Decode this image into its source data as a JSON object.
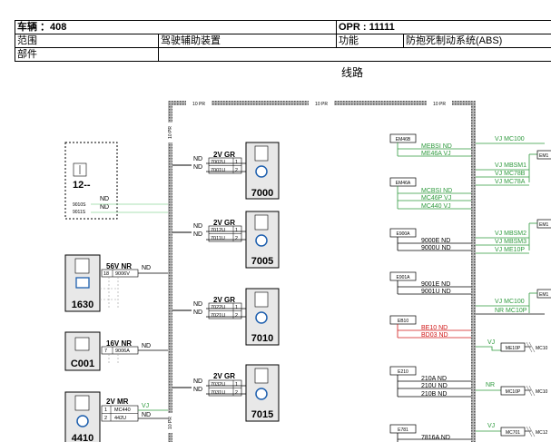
{
  "header": {
    "vehicle": "车辆 ：408",
    "opr": "OPR : 11111",
    "scope_label": "范围",
    "scope_value": "驾驶辅助装置",
    "function_label": "功能",
    "function_value": "防抱死制动系统(ABS)",
    "parts_label": "部件",
    "parts_value": ""
  },
  "diagram_title": "线路",
  "frame": {
    "top_labels": [
      "10 PR",
      "10 PR",
      "10 PR"
    ],
    "side_label": "10 PR"
  },
  "sensors": [
    {
      "id": "7000",
      "wire": "2V GR",
      "ends": [
        "ND",
        "ND"
      ],
      "pins": [
        [
          "7002U",
          "1"
        ],
        [
          "7001U",
          "2"
        ]
      ]
    },
    {
      "id": "7005",
      "wire": "2V GR",
      "ends": [
        "ND",
        "ND"
      ],
      "pins": [
        [
          "7012U",
          "1"
        ],
        [
          "7011U",
          "2"
        ]
      ]
    },
    {
      "id": "7010",
      "wire": "2V GR",
      "ends": [
        "ND",
        "ND"
      ],
      "pins": [
        [
          "7022U",
          "1"
        ],
        [
          "7021U",
          "2"
        ]
      ]
    },
    {
      "id": "7015",
      "wire": "2V GR",
      "ends": [
        "ND",
        "ND"
      ],
      "pins": [
        [
          "7032U",
          "1"
        ],
        [
          "7031U",
          "2"
        ]
      ]
    }
  ],
  "left_components": {
    "c12": {
      "id": "12--",
      "codes": [
        "9010S",
        "9011S"
      ],
      "ends": [
        "ND",
        "ND"
      ]
    },
    "c1630": {
      "id": "1630",
      "wire": "56V NR",
      "pin": [
        "18",
        "9006V"
      ],
      "end": "ND"
    },
    "c001": {
      "id": "C001",
      "wire": "16V NR",
      "pin": [
        "7",
        "9006A"
      ],
      "end": "ND"
    },
    "c4410": {
      "id": "4410",
      "wire": "2V MR",
      "pins": [
        [
          "1",
          "MC440"
        ],
        [
          "2",
          "442U"
        ]
      ],
      "ends": [
        "VJ",
        "ND"
      ]
    }
  },
  "splices": [
    {
      "id": "EM46B",
      "labels": [
        "MEBSI ND",
        "ME46A VJ"
      ]
    },
    {
      "id": "EM46A",
      "labels": [
        "MCBSI ND",
        "MC46P VJ",
        "MC440 VJ"
      ]
    },
    {
      "id": "E900A",
      "labels": [
        "9000E ND",
        "9000U ND"
      ]
    },
    {
      "id": "E901A",
      "labels": [
        "9001E ND",
        "9001U ND"
      ]
    },
    {
      "id": "EB10",
      "labels": [
        "BE10 ND",
        "BD03 ND"
      ]
    },
    {
      "id": "E210",
      "labels": [
        "210A ND",
        "210U ND",
        "210B ND"
      ]
    },
    {
      "id": "E781",
      "labels": [
        "7816A ND"
      ]
    }
  ],
  "right_wires": {
    "g1": [
      "VJ MC100",
      "VJ MBSM1",
      "VJ MC78B",
      "VJ MC78A"
    ],
    "g2": [
      "VJ MBSM2",
      "VJ MBSM3",
      "VJ ME10P"
    ],
    "g3": [
      "VJ MC100",
      "NR MC10P"
    ],
    "edge_conn": [
      "EM1",
      "EM1",
      "EM1"
    ]
  },
  "grounds": [
    {
      "color": "VJ",
      "code": "ME10P",
      "dest": "MC10"
    },
    {
      "color": "NR",
      "code": "MC10P",
      "dest": "MC10"
    },
    {
      "color": "VJ",
      "code": "MC701",
      "dest": "MC12"
    }
  ],
  "colors": {
    "green": "#2f9a3e",
    "red": "#d01818",
    "gray": "#8a8a8a"
  }
}
